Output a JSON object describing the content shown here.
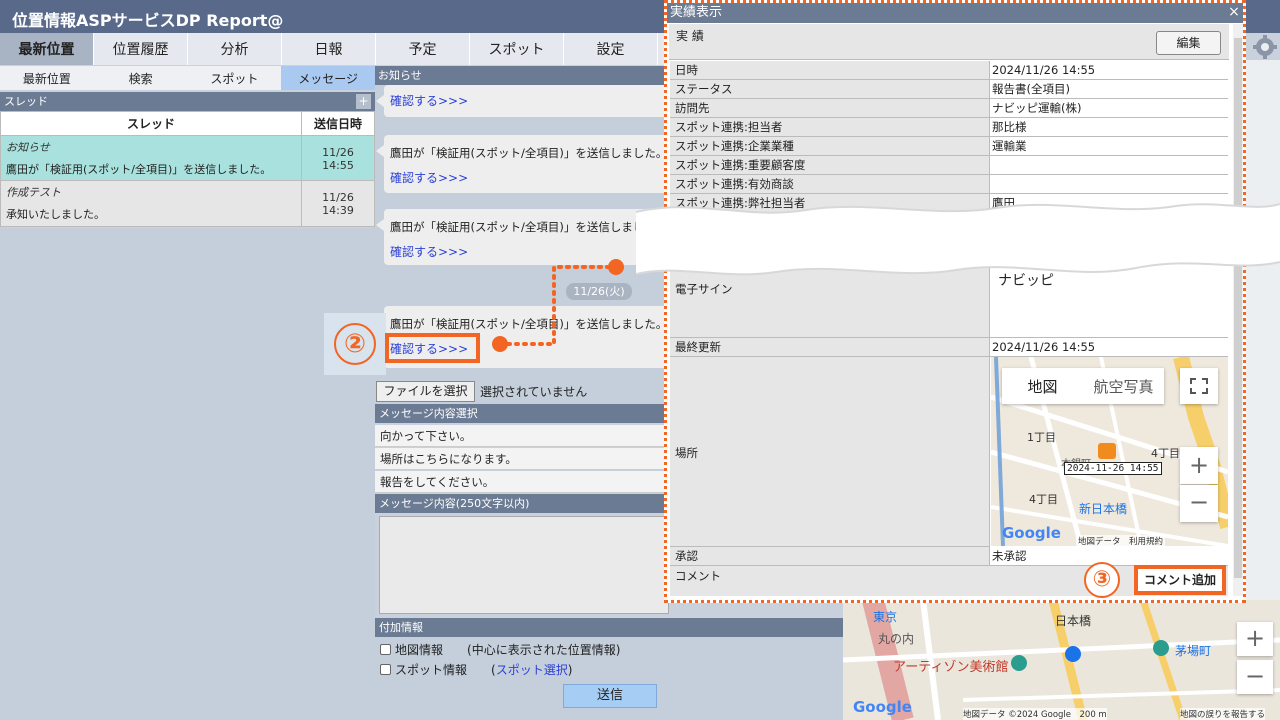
{
  "app": {
    "title": "位置情報ASPサービスDP Report@"
  },
  "main_nav": [
    "最新位置",
    "位置履歴",
    "分析",
    "日報",
    "予定",
    "スポット",
    "設定"
  ],
  "sub_nav": [
    "最新位置",
    "検索",
    "スポット",
    "メッセージ"
  ],
  "thread_panel": {
    "header": "スレッド",
    "add_label": "+",
    "col_thread": "スレッド",
    "col_date": "送信日時",
    "rows": [
      {
        "title": "お知らせ",
        "preview": "鷹田が「検証用(スポット/全項目)」を送信しました。",
        "date": "11/26",
        "time": "14:55"
      },
      {
        "title": "作成テスト",
        "preview": "承知いたしました。",
        "date": "11/26",
        "time": "14:39"
      }
    ]
  },
  "notice": {
    "header": "お知らせ",
    "link": "確認する>>>",
    "message": "鷹田が「検証用(スポット/全項目)」を送信しました。",
    "message_cut": "鷹田が「検証用(スポット/全項目)」を送信しまし",
    "date_pill": "11/26(火)"
  },
  "file": {
    "button": "ファイルを選択",
    "status": "選択されていません"
  },
  "templates": {
    "header": "メッセージ内容選択",
    "items": [
      "向かって下さい。",
      "場所はこちらになります。",
      "報告をしてください。"
    ]
  },
  "message_input": {
    "header": "メッセージ内容(250文字以内)"
  },
  "extra": {
    "header": "付加情報",
    "map_label": "地図情報",
    "map_hint": "(中心に表示された位置情報)",
    "spot_label": "スポット情報",
    "spot_hint_open": "(",
    "spot_hint_link": "スポット選択",
    "spot_hint_close": ")"
  },
  "send_label": "送信",
  "dialog": {
    "title": "実績表示",
    "close": "×",
    "section": "実 績",
    "edit": "編集",
    "fields": [
      {
        "k": "日時",
        "v": "2024/11/26 14:55"
      },
      {
        "k": "ステータス",
        "v": "報告書(全項目)"
      },
      {
        "k": "訪問先",
        "v": "ナビッピ運輸(株)"
      },
      {
        "k": "スポット連携:担当者",
        "v": "那比様"
      },
      {
        "k": "スポット連携:企業業種",
        "v": "運輸業"
      },
      {
        "k": "スポット連携:重要顧客度",
        "v": ""
      },
      {
        "k": "スポット連携:有効商談",
        "v": ""
      },
      {
        "k": "スポット連携:弊社担当者",
        "v": "鷹田"
      }
    ],
    "sign_label": "電子サイン",
    "sign_value": "ナビッピ",
    "last_label": "最終更新",
    "last_value": "2024/11/26 14:55",
    "location_label": "場所",
    "approval_label": "承認",
    "approval_value": "未承認",
    "comment_label": "コメント",
    "comment_button": "コメント追加"
  },
  "map": {
    "tab_map": "地図",
    "tab_aerial": "航空写真",
    "stamp": "2024-11-26 14:55",
    "block1": "1丁目",
    "block2": "4丁目",
    "block3": "4丁目",
    "station": "新日本橋",
    "road": "本銀町",
    "zoom_in": "+",
    "zoom_out": "−",
    "google": "Google",
    "footer": "地図データ　利用規約"
  },
  "bg_map": {
    "tokyo": "東京",
    "marunouchi": "丸の内",
    "museum": "アーティゾン美術館",
    "nihonbashi": "日本橋",
    "kayabacho": "茅場町",
    "footer": "地図データ ©2024 Google　200 m",
    "report": "地図の誤りを報告する",
    "google": "Google"
  },
  "annotations": {
    "two": "②",
    "three": "③"
  },
  "colors": {
    "orange": "#f26522",
    "header": "#58698a",
    "section": "#6b7b93",
    "link": "#2a3fd6"
  }
}
